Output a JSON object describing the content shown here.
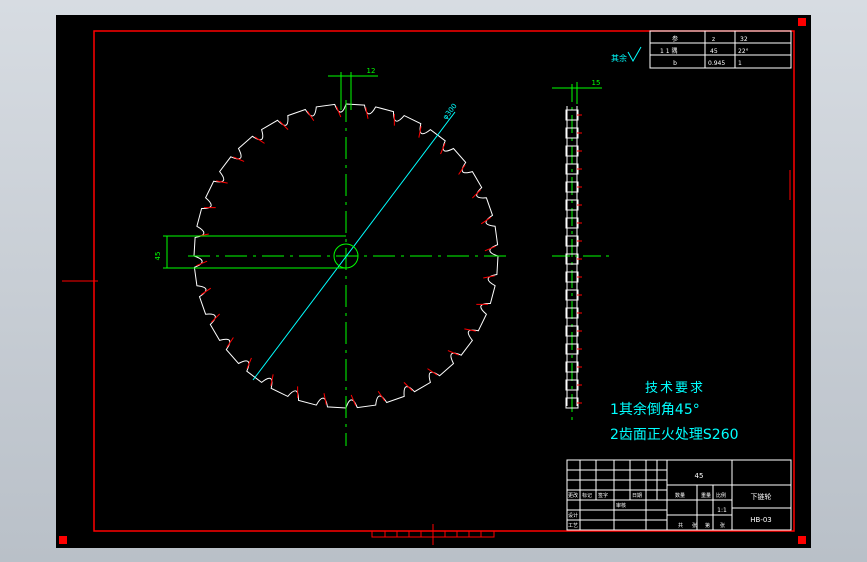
{
  "dimensions": {
    "tooth_width": "12",
    "hole_dim": "45",
    "radius_label": "φ300",
    "side_thickness": "15"
  },
  "surface_finish": "其余",
  "param_table": {
    "rows": [
      [
        "参",
        "z",
        "32"
      ],
      [
        "1 1 隅",
        "45",
        "22°"
      ],
      [
        "b",
        "0.945",
        "1"
      ]
    ]
  },
  "tech_requirements": {
    "title": "技术要求",
    "line1": "1其余倒角45°",
    "line2": "2齿面正火处理S260"
  },
  "title_block": {
    "material": "45",
    "part_name": "下链轮",
    "drawing_no": "HB-03",
    "scale": "1:1",
    "cells": [
      "更改",
      "标记",
      "签字",
      "日期",
      "设计",
      "审核",
      "工艺",
      "数量",
      "重量",
      "比例",
      "共",
      "张",
      "第",
      "张"
    ]
  },
  "colors": {
    "background": "#000000",
    "frame": "#ff0000",
    "geometry": "#ffffff",
    "dimension": "#00ff00",
    "construction": "#00ffff",
    "annotation": "#00ffff"
  }
}
